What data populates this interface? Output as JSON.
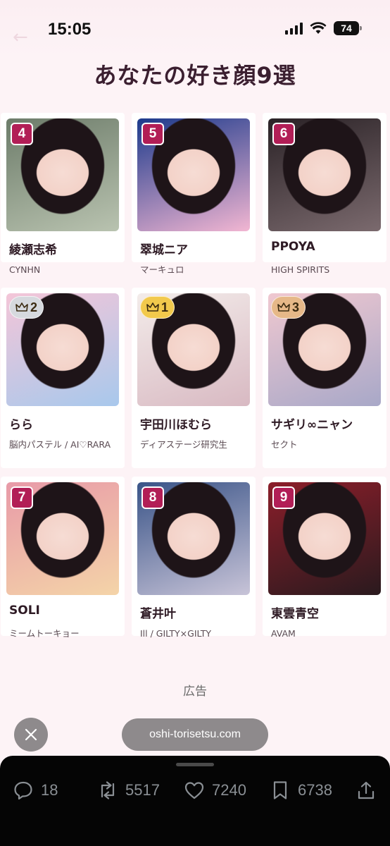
{
  "status_bar": {
    "time": "15:05",
    "battery": "74"
  },
  "page": {
    "title": "あなたの好き顔9選"
  },
  "cards": [
    {
      "rank": "4",
      "name": "綾瀬志希",
      "group": "CYNHN",
      "crown": false,
      "photo_colors": [
        "#6d7c6a",
        "#b9c3b0"
      ]
    },
    {
      "rank": "5",
      "name": "翠城ニア",
      "group": "マーキュロ",
      "crown": false,
      "photo_colors": [
        "#1c3a8c",
        "#f2b6d2"
      ]
    },
    {
      "rank": "6",
      "name": "PPOYA",
      "group": "HIGH SPIRITS",
      "crown": false,
      "photo_colors": [
        "#2a2226",
        "#7b6a6e"
      ]
    },
    {
      "rank": "2",
      "name": "らら",
      "group": "脳内パステル / AI♡RARA",
      "crown": true,
      "crown_color": "silver",
      "photo_colors": [
        "#f4c6d8",
        "#a8c8ec"
      ]
    },
    {
      "rank": "1",
      "name": "宇田川ほむら",
      "group": "ディアステージ研究生",
      "crown": true,
      "crown_color": "gold",
      "photo_colors": [
        "#f3ecea",
        "#d8b9c2"
      ]
    },
    {
      "rank": "3",
      "name": "サギリ∞ニャン",
      "group": "セクト",
      "crown": true,
      "crown_color": "bronze",
      "photo_colors": [
        "#f0c8d0",
        "#a8a8c8"
      ]
    },
    {
      "rank": "7",
      "name": "SOLI",
      "group": "ミームトーキョー",
      "crown": false,
      "photo_colors": [
        "#e89aa8",
        "#f4d4a8"
      ]
    },
    {
      "rank": "8",
      "name": "蒼井叶",
      "group": "Ill / GILTY×GILTY",
      "crown": false,
      "photo_colors": [
        "#3a5488",
        "#c8c4d8"
      ]
    },
    {
      "rank": "9",
      "name": "東雲青空",
      "group": "AVAM",
      "crown": false,
      "photo_colors": [
        "#8c1e2a",
        "#2a1a1e"
      ]
    }
  ],
  "ad": {
    "label": "広告",
    "url": "oshi-torisetsu.com"
  },
  "actions": {
    "replies": "18",
    "reposts": "5517",
    "likes": "7240",
    "bookmarks": "6738"
  },
  "colors": {
    "rank_badge": "#b21e56",
    "crown_gold": "#f2c94c",
    "crown_silver": "#d6d9de",
    "crown_bronze": "#e6b888"
  }
}
